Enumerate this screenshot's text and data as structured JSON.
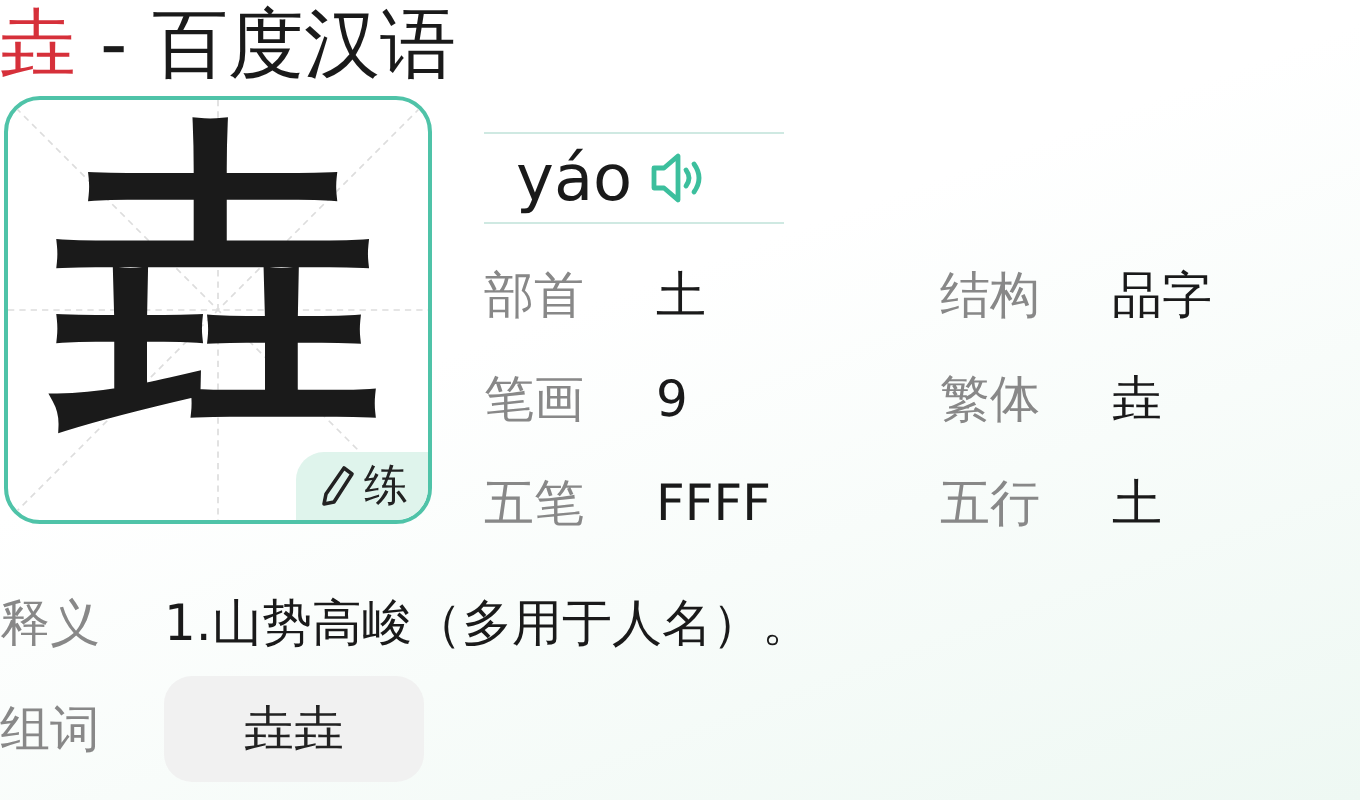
{
  "title": {
    "character": "垚",
    "suffix": "- 百度汉语"
  },
  "glyph": {
    "character": "垚",
    "practice": "练"
  },
  "pinyin": "yáo",
  "attributes": [
    {
      "label": "部首",
      "value": "土"
    },
    {
      "label": "结构",
      "value": "品字"
    },
    {
      "label": "笔画",
      "value": "9"
    },
    {
      "label": "繁体",
      "value": "垚"
    },
    {
      "label": "五笔",
      "value": "FFFF"
    },
    {
      "label": "五行",
      "value": "土"
    }
  ],
  "definition": {
    "label": "释义",
    "text": "1.山势高峻（多用于人名）。"
  },
  "words": {
    "label": "组词",
    "items": [
      "垚垚"
    ]
  }
}
